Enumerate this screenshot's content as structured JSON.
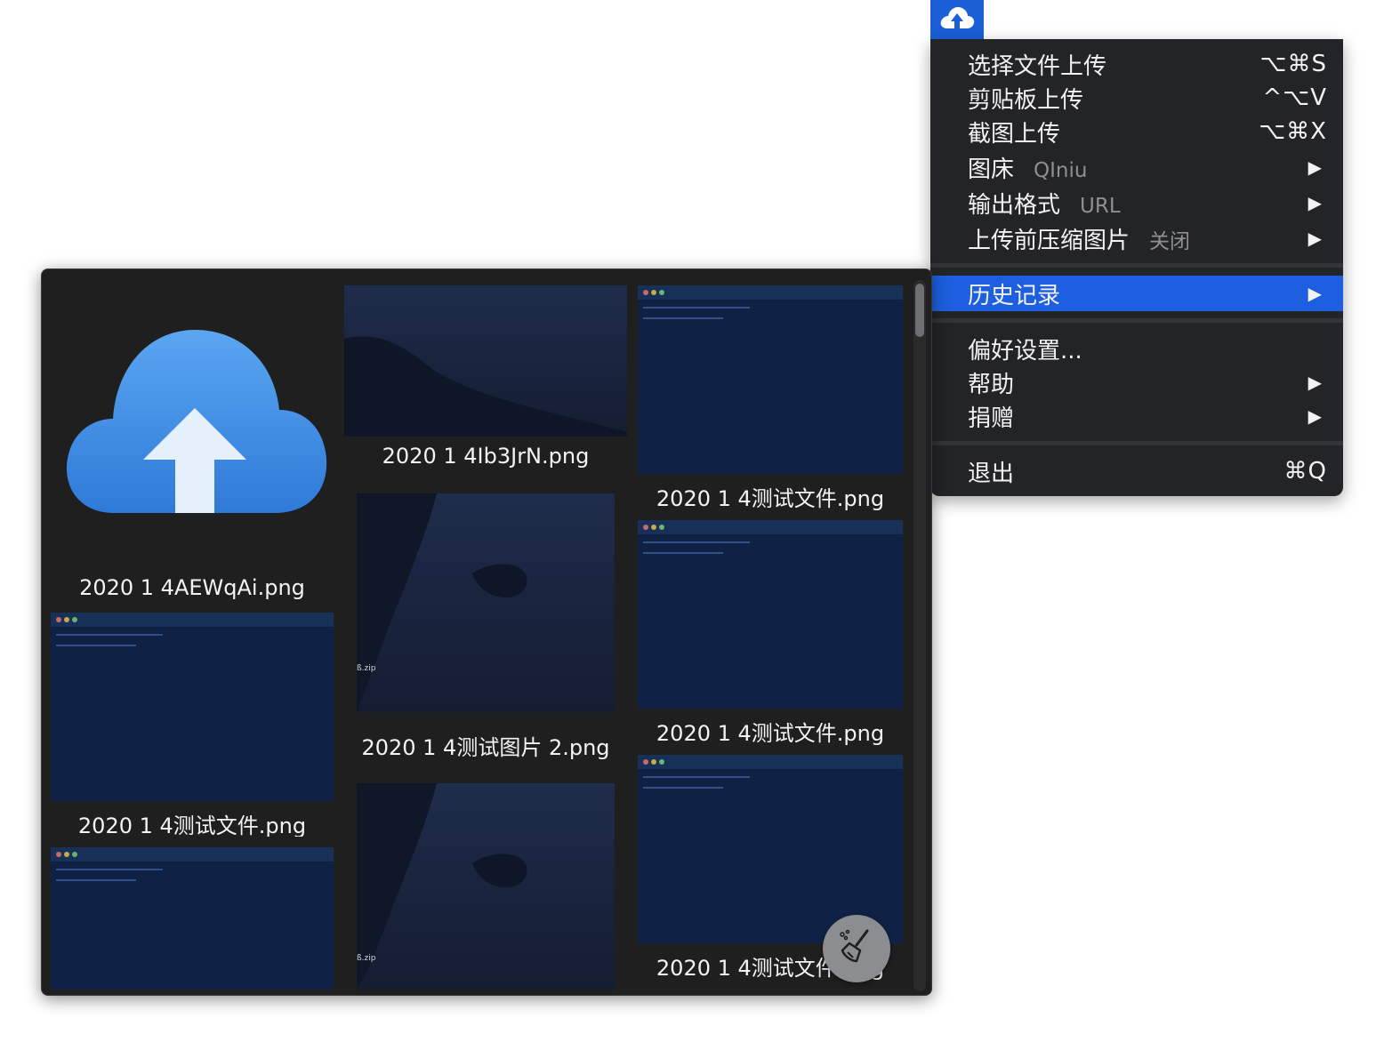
{
  "menubar": {
    "icon": "cloud-upload-icon",
    "accent": "#1b5fd6"
  },
  "menu": {
    "items": [
      {
        "label": "选择文件上传",
        "shortcut": "⌥⌘S"
      },
      {
        "label": "剪贴板上传",
        "shortcut": "^⌥V"
      },
      {
        "label": "截图上传",
        "shortcut": "⌥⌘X"
      },
      {
        "label": "图床",
        "value": "QIniu",
        "arrow": "▶"
      },
      {
        "label": "输出格式",
        "value": "URL",
        "arrow": "▶"
      },
      {
        "label": "上传前压缩图片",
        "value": "关闭",
        "arrow": "▶"
      },
      {
        "label": "历史记录",
        "arrow": "▶",
        "selected": true
      },
      {
        "label": "偏好设置..."
      },
      {
        "label": "帮助",
        "arrow": "▶"
      },
      {
        "label": "捐赠",
        "arrow": "▶"
      },
      {
        "label": "退出",
        "shortcut": "⌘Q"
      }
    ],
    "selected_color": "#1d5fe0"
  },
  "history": {
    "files": [
      "2020 1 4AEWqAi.png",
      "2020 1 4Ib3JrN.png",
      "2020 1 4测试文件.png",
      "2020 1 4测试图片 2.png",
      "2020 1 4测试文件.png",
      "2020 1 4测试文件.png",
      "2020 1 4测试文件.png"
    ],
    "zip_label": "ß.zip",
    "clean_icon": "broom-icon"
  }
}
